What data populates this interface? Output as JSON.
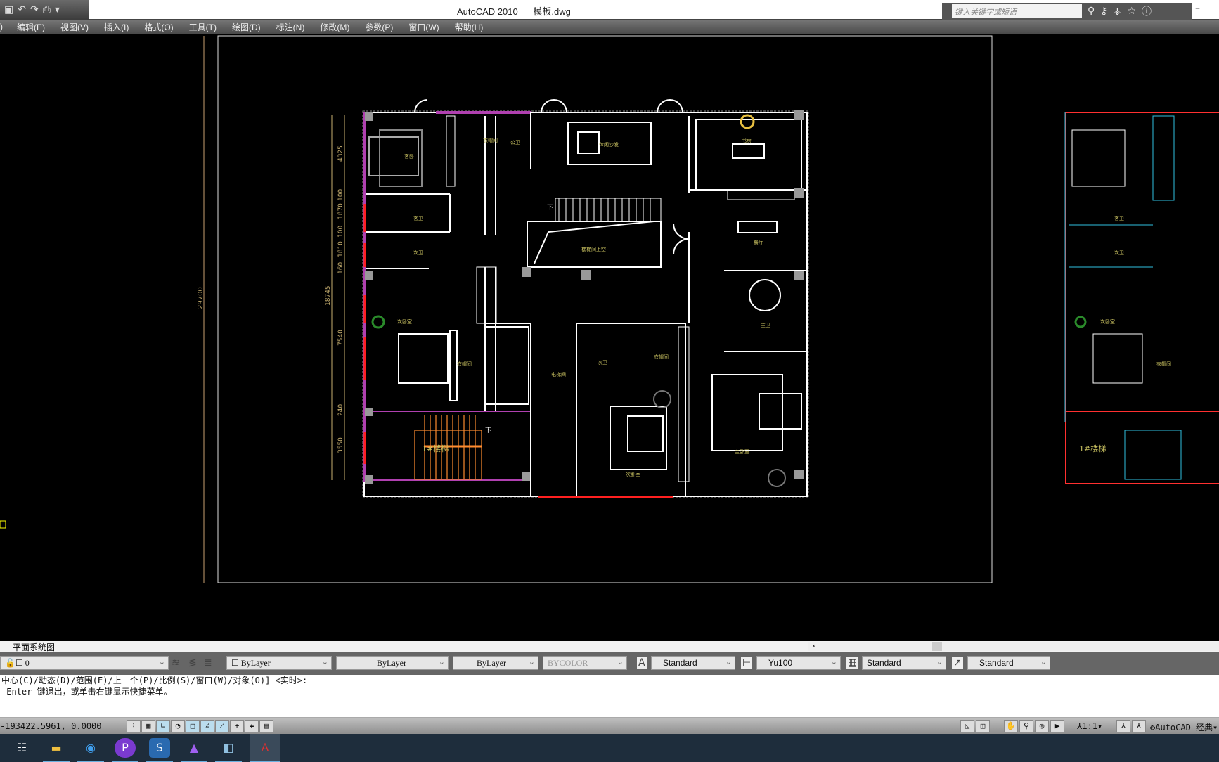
{
  "titlebar": {
    "app": "AutoCAD 2010",
    "file": "模板.dwg",
    "search_placeholder": "键入关键字或短语",
    "quick_access": [
      "save-icon",
      "undo-icon",
      "redo-icon",
      "plot-icon",
      "customize-icon"
    ],
    "info_icons": [
      "binoculars-icon",
      "key-icon",
      "satellite-icon",
      "star-icon",
      "help-icon"
    ]
  },
  "menu": [
    "编辑(E)",
    "视图(V)",
    "插入(I)",
    "格式(O)",
    "工具(T)",
    "绘图(D)",
    "标注(N)",
    "修改(M)",
    "参数(P)",
    "窗口(W)",
    "帮助(H)"
  ],
  "drawing": {
    "dimensions_left": [
      "4325",
      "100",
      "1870",
      "100",
      "1810",
      "160",
      "7540",
      "240",
      "3550"
    ],
    "dimension_total": "18745",
    "dimension_overall": "29700",
    "rooms": [
      "客卧",
      "衣帽间",
      "公卫",
      "客卫",
      "次卫",
      "次卧室",
      "衣帽间",
      "1#楼梯",
      "休闲沙发",
      "楼梯间上空",
      "书房",
      "餐厅",
      "主卫",
      "电梯间",
      "次卫",
      "衣帽间",
      "次卧室",
      "主卧室"
    ],
    "stair_down": "下",
    "right_rooms": [
      "1#楼梯",
      "客卫",
      "次卫",
      "次卧室",
      "衣帽间"
    ],
    "colors": {
      "wall": "#ffffff",
      "window": "#ff2020",
      "column": "#b040b0",
      "stair": "#ff8c30",
      "label": "#c8c060",
      "dim": "#c8b070"
    }
  },
  "layout_tab": "平面系统图",
  "properties": {
    "layer": "0",
    "color": "ByLayer",
    "linetype": "ByLayer",
    "lineweight": "ByLayer",
    "plotstyle": "BYCOLOR",
    "text_style": "Standard",
    "dim_style": "Yu100",
    "table_style": "Standard",
    "mleader_style": "Standard"
  },
  "command": {
    "line1": "中心(C)/动态(D)/范围(E)/上一个(P)/比例(S)/窗口(W)/对象(O)] <实时>:",
    "line2": " Enter 键退出，或单击右键显示快捷菜单。"
  },
  "status": {
    "coords": "-193422.5961, 0.0000",
    "annotation_scale": "1:1",
    "workspace": "AutoCAD 经典"
  },
  "taskbar": [
    "task-view-icon",
    "file-explorer-icon",
    "browser-icon",
    "p-app-icon",
    "sketchup-icon",
    "image-app-icon",
    "notes-app-icon",
    "autocad-icon"
  ]
}
